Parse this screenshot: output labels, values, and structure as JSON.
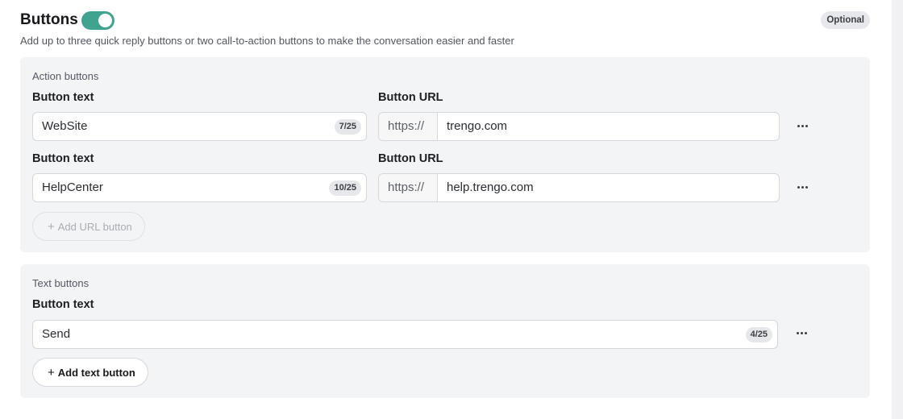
{
  "section": {
    "title": "Buttons",
    "toggle_on": true,
    "badge": "Optional",
    "description": "Add up to three quick reply buttons or two call-to-action buttons to make the conversation easier and faster"
  },
  "action_buttons": {
    "label": "Action buttons",
    "text_label": "Button text",
    "url_label": "Button URL",
    "url_prefix": "https://",
    "items": [
      {
        "text": "WebSite",
        "counter": "7/25",
        "url": "trengo.com"
      },
      {
        "text": "HelpCenter",
        "counter": "10/25",
        "url": "help.trengo.com"
      }
    ],
    "add_label": "Add URL button"
  },
  "text_buttons": {
    "label": "Text buttons",
    "text_label": "Button text",
    "items": [
      {
        "text": "Send",
        "counter": "4/25"
      }
    ],
    "add_label": "Add text button"
  },
  "colors": {
    "toggle_accent": "#3fa38f",
    "panel_background": "#f3f4f6"
  },
  "icons": {
    "more": "more-horizontal-icon",
    "plus": "plus-icon"
  }
}
